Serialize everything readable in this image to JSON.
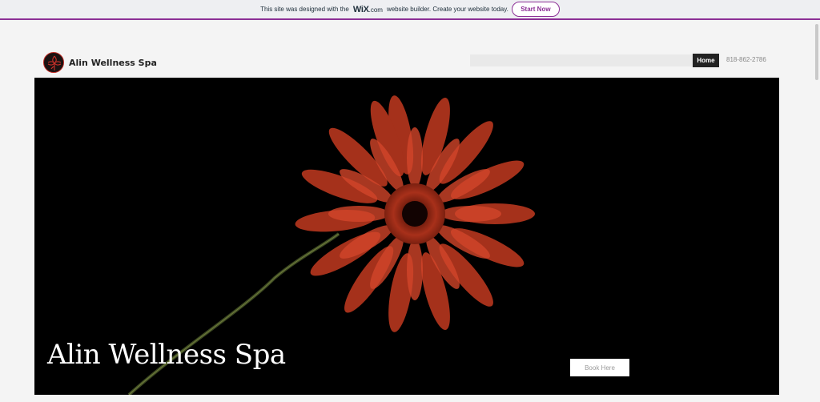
{
  "banner": {
    "text_before": "This site was designed with the",
    "brand": "WiX",
    "brand_suffix": ".com",
    "text_after": "website builder. Create your website today.",
    "cta_label": "Start Now",
    "accent_color": "#8c2f96"
  },
  "header": {
    "site_name": "Alin Wellness Spa",
    "logo_icon": "flower-logo-icon",
    "nav_items": [
      {
        "label": "Home",
        "active": true
      }
    ],
    "phone": "818-862-2786"
  },
  "hero": {
    "title": "Alin Wellness Spa",
    "book_label": "Book Here",
    "image": "red-gerbera-flower-on-black"
  }
}
